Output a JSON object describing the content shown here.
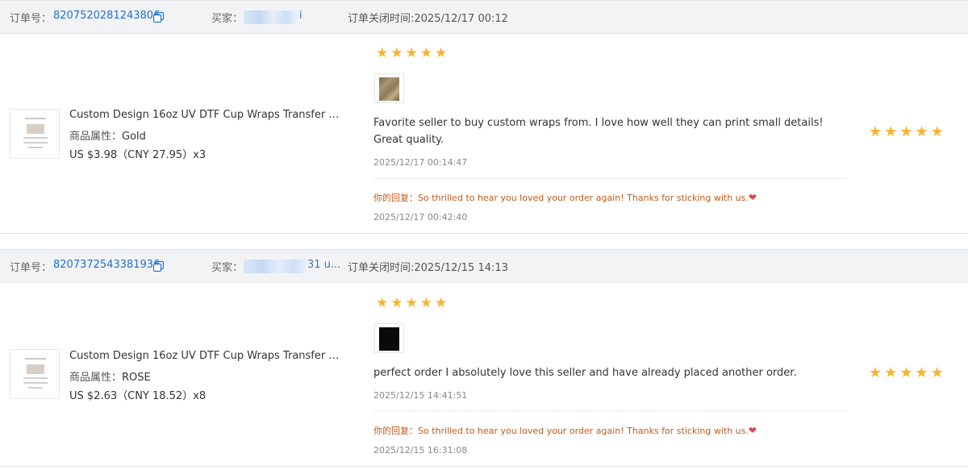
{
  "labels": {
    "order_no": "订单号：",
    "buyer": "买家：",
    "close_time_prefix": "订单关闭时间:",
    "attr_key": "商品属性：",
    "reply_prefix": "你的回复："
  },
  "colors": {
    "link": "#1f6fd1",
    "star": "#f7b52c",
    "reply": "#c15b18",
    "header_bg": "#f2f3f5"
  },
  "orders": [
    {
      "order_no": "8207520281243806",
      "buyer_tail": "i",
      "close_time": "2025/12/17 00:12",
      "product": {
        "title": "Custom Design 16oz UV DTF Cup Wraps Transfer Stick...",
        "attr": "Gold",
        "price": "US $3.98（CNY  27.95）x3"
      },
      "buyer_rating": 5,
      "review": {
        "image": "photo",
        "text": "Favorite seller to buy custom wraps from. I love how well they can print small details! Great quality.",
        "time": "2025/12/17 00:14:47",
        "reply": "So thrilled to hear you loved your order again! Thanks for sticking with us.",
        "reply_icon": "heart-icon",
        "reply_time": "2025/12/17 00:42:40"
      },
      "seller_rating": 5
    },
    {
      "order_no": "8207372543381936",
      "buyer_tail": "31 u...",
      "close_time": "2025/12/15 14:13",
      "product": {
        "title": "Custom Design 16oz UV DTF Cup Wraps Transfer Stick...",
        "attr": "ROSE",
        "price": "US $2.63（CNY  18.52）x8"
      },
      "buyer_rating": 5,
      "review": {
        "image": "black",
        "text": "perfect order I absolutely love this seller and have already placed another order.",
        "time": "2025/12/15 14:41:51",
        "reply": "So thrilled to hear you loved your order again! Thanks for sticking with us.",
        "reply_icon": "heart-icon",
        "reply_time": "2025/12/15 16:31:08"
      },
      "seller_rating": 5
    }
  ]
}
